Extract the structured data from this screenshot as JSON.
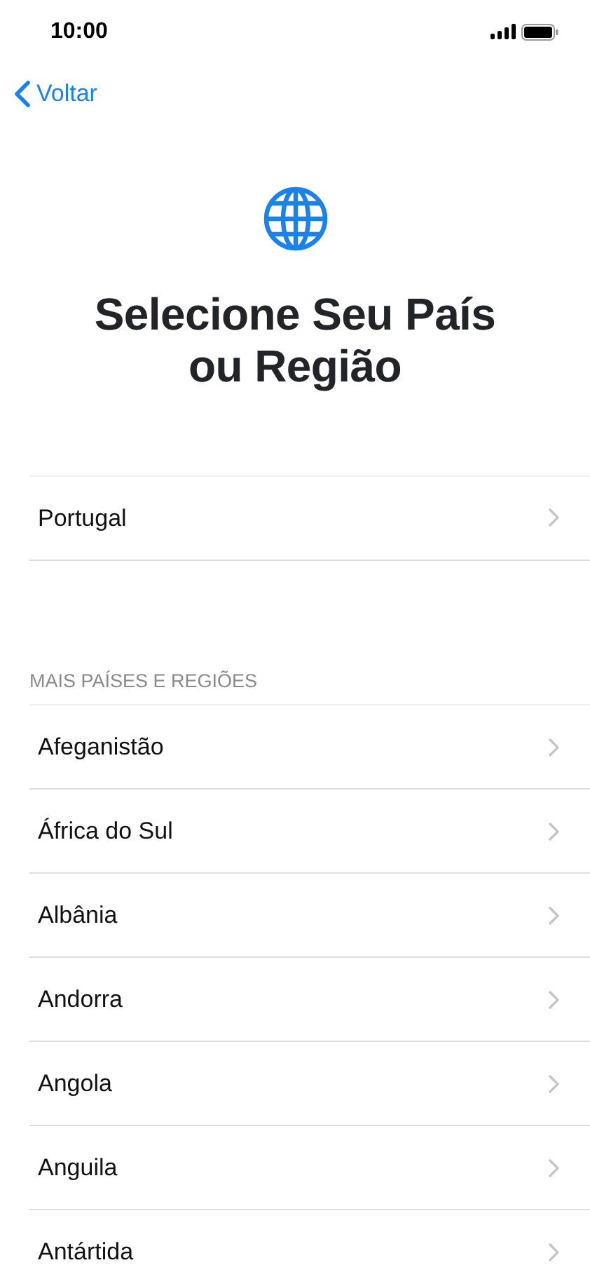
{
  "status_bar": {
    "time": "10:00"
  },
  "nav": {
    "back_label": "Voltar"
  },
  "title": "Selecione Seu País ou Região",
  "suggested": [
    {
      "label": "Portugal"
    }
  ],
  "section_header": "MAIS PAÍSES E REGIÕES",
  "countries": [
    {
      "label": "Afeganistão"
    },
    {
      "label": "África do Sul"
    },
    {
      "label": "Albânia"
    },
    {
      "label": "Andorra"
    },
    {
      "label": "Angola"
    },
    {
      "label": "Anguila"
    },
    {
      "label": "Antártida"
    }
  ]
}
